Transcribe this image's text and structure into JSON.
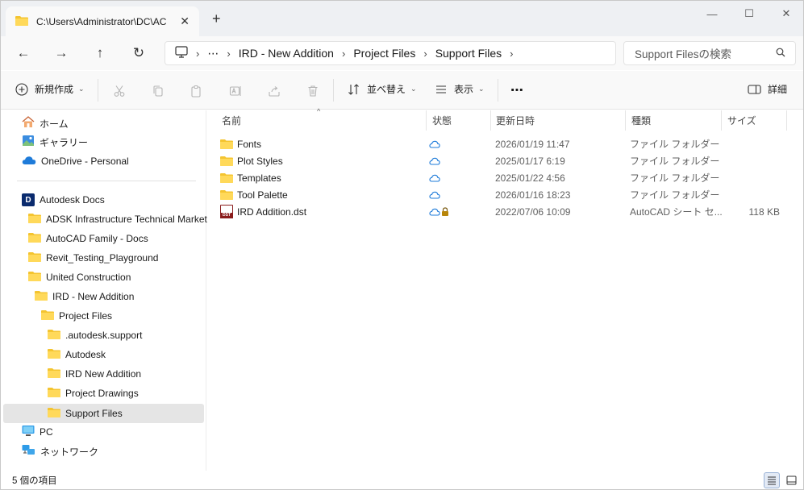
{
  "tab": {
    "title": "C:\\Users\\Administrator\\DC\\AC",
    "close_glyph": "✕",
    "new_tab_glyph": "+"
  },
  "window_controls": {
    "minimize": "—",
    "maximize": "☐",
    "close": "✕"
  },
  "nav": {
    "back": "←",
    "forward": "→",
    "up": "↑",
    "refresh": "↻"
  },
  "address": {
    "overflow": "⋯",
    "separator": "›",
    "crumbs": [
      "IRD - New Addition",
      "Project Files",
      "Support Files"
    ]
  },
  "search": {
    "placeholder": "Support Filesの検索"
  },
  "commandbar": {
    "new_label": "新規作成",
    "sort_label": "並べ替え",
    "view_label": "表示",
    "more_label": "⋯",
    "details_label": "詳細",
    "chevron": "⌄"
  },
  "sidebar": {
    "items": [
      {
        "label": "ホーム",
        "icon": "home-icon"
      },
      {
        "label": "ギャラリー",
        "icon": "gallery-icon"
      },
      {
        "label": "OneDrive - Personal",
        "icon": "onedrive-cloud-icon"
      },
      {
        "label": "Autodesk Docs",
        "icon": "autodesk-docs-icon"
      },
      {
        "label": "ADSK Infrastructure Technical Market",
        "icon": "folder-icon"
      },
      {
        "label": "AutoCAD Family - Docs",
        "icon": "folder-icon"
      },
      {
        "label": "Revit_Testing_Playground",
        "icon": "folder-icon"
      },
      {
        "label": "United Construction",
        "icon": "folder-icon"
      },
      {
        "label": "IRD - New Addition",
        "icon": "folder-icon"
      },
      {
        "label": "Project Files",
        "icon": "folder-icon"
      },
      {
        "label": ".autodesk.support",
        "icon": "folder-icon"
      },
      {
        "label": "Autodesk",
        "icon": "folder-icon"
      },
      {
        "label": "IRD New Addition",
        "icon": "folder-icon"
      },
      {
        "label": "Project Drawings",
        "icon": "folder-icon"
      },
      {
        "label": "Support Files",
        "icon": "folder-icon"
      },
      {
        "label": "PC",
        "icon": "pc-icon"
      },
      {
        "label": "ネットワーク",
        "icon": "network-icon"
      }
    ],
    "autodesk_badge": "D"
  },
  "columns": {
    "name": "名前",
    "status": "状態",
    "modified": "更新日時",
    "type": "種類",
    "size": "サイズ"
  },
  "files": [
    {
      "name": "Fonts",
      "modified": "2026/01/19 11:47",
      "type": "ファイル フォルダー",
      "size": "",
      "icon": "folder-icon",
      "status": "cloud"
    },
    {
      "name": "Plot Styles",
      "modified": "2025/01/17 6:19",
      "type": "ファイル フォルダー",
      "size": "",
      "icon": "folder-icon",
      "status": "cloud"
    },
    {
      "name": "Templates",
      "modified": "2025/01/22 4:56",
      "type": "ファイル フォルダー",
      "size": "",
      "icon": "folder-icon",
      "status": "cloud"
    },
    {
      "name": "Tool Palette",
      "modified": "2026/01/16 18:23",
      "type": "ファイル フォルダー",
      "size": "",
      "icon": "folder-icon",
      "status": "cloud"
    },
    {
      "name": "IRD Addition.dst",
      "modified": "2022/07/06 10:09",
      "type": "AutoCAD シート セ...",
      "size": "118 KB",
      "icon": "dst-file-icon",
      "status": "cloud-locked"
    }
  ],
  "dst_badge": "DST",
  "status": {
    "count_text": "5 個の項目"
  },
  "colors": {
    "folder": "#f4c430",
    "accent": "#1f6fd1",
    "selection": "#e5e5e5"
  }
}
